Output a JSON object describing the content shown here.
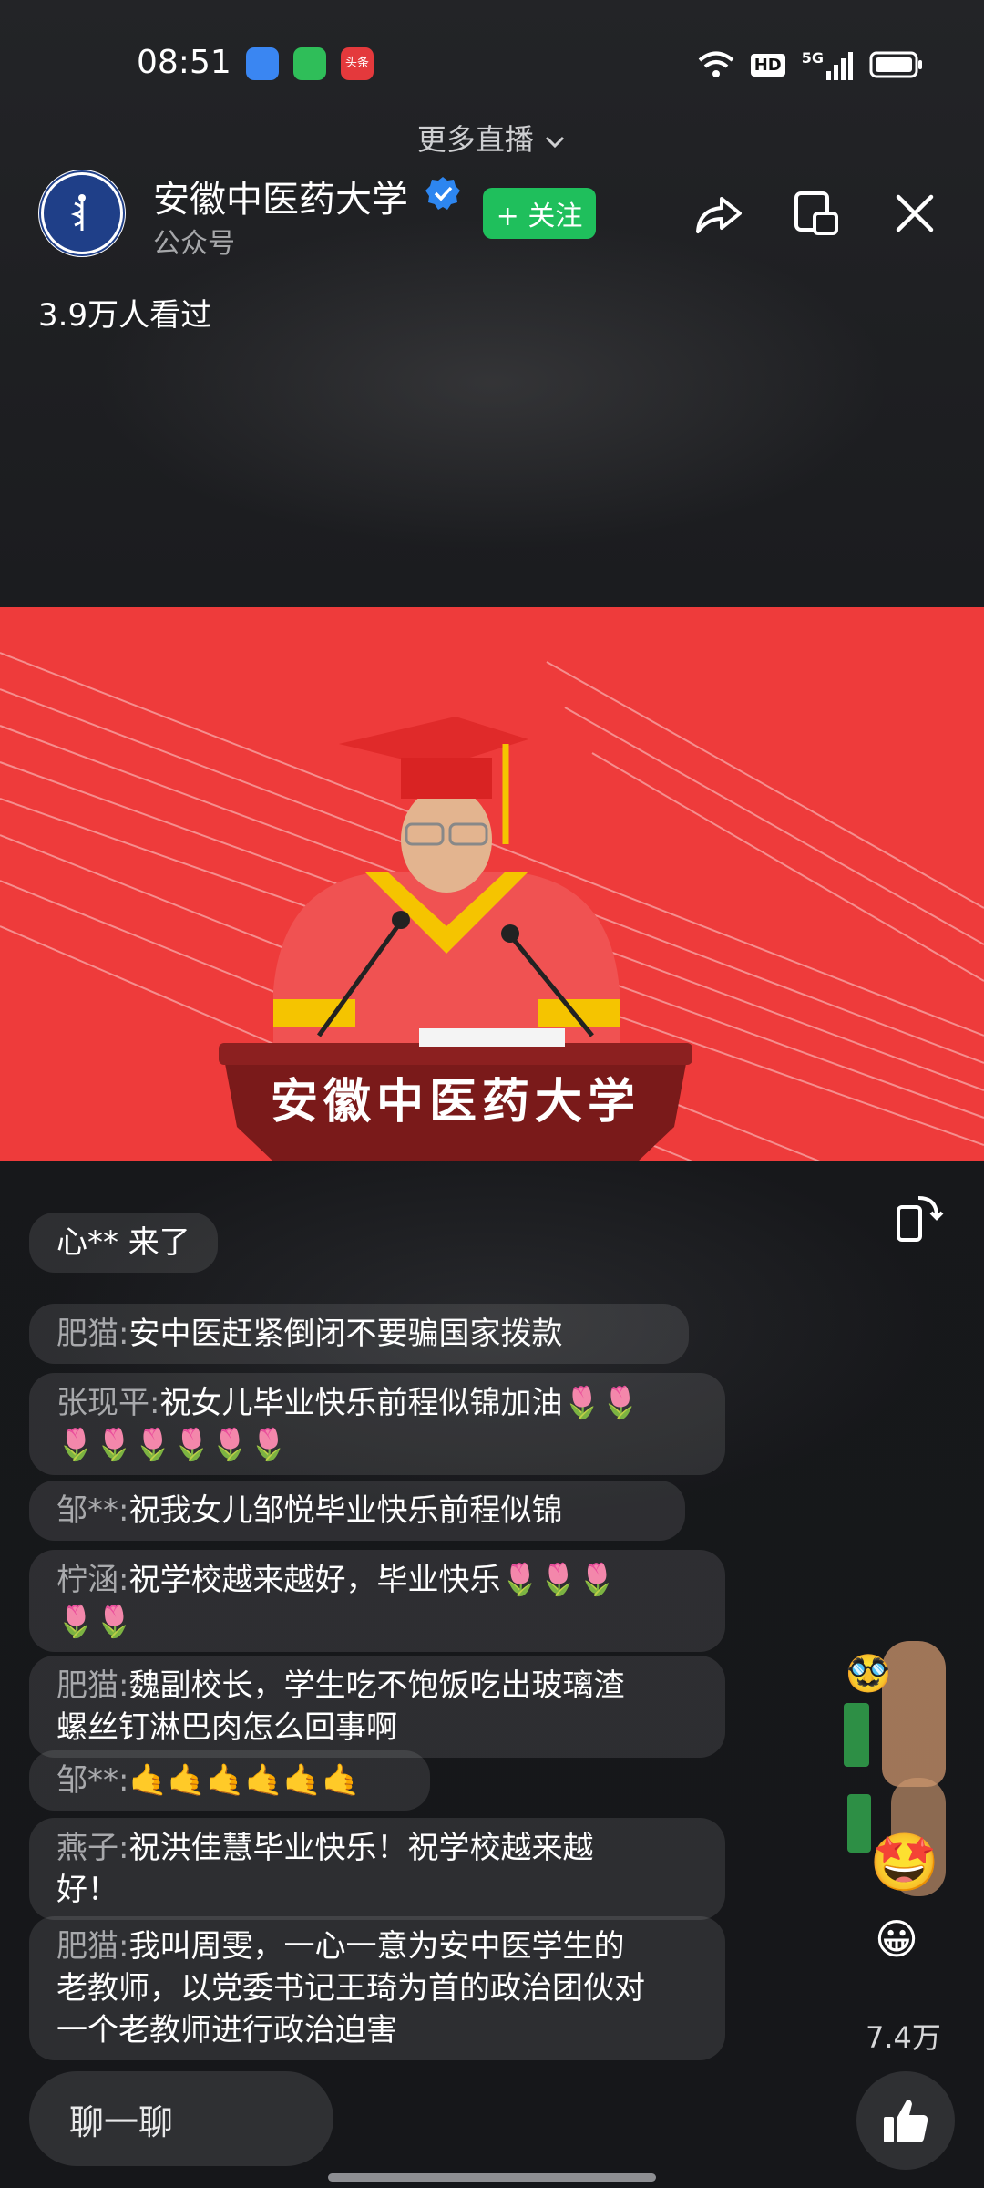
{
  "status_bar": {
    "time": "08:51",
    "hd": "HD",
    "net": "5G"
  },
  "header": {
    "more_live": "更多直播",
    "account_name": "安徽中医药大学",
    "account_type": "公众号",
    "follow_label": "+ 关注",
    "viewers": "3.9万人看过"
  },
  "video": {
    "podium_text": "安徽中医药大学"
  },
  "feed": {
    "join_notice": "心** 来了",
    "comments": [
      {
        "name": "肥猫:",
        "text": "安中医赶紧倒闭不要骗国家拨款"
      },
      {
        "name": "张现平:",
        "text": "祝女儿毕业快乐前程似锦加油🌷🌷",
        "text2": "🌷🌷🌷🌷🌷🌷"
      },
      {
        "name": "邹**:",
        "text": "祝我女儿邹悦毕业快乐前程似锦"
      },
      {
        "name": "柠涵:",
        "text": "祝学校越来越好，毕业快乐🌷🌷🌷",
        "text2": "🌷🌷"
      },
      {
        "name": "肥猫:",
        "text": "魏副校长，学生吃不饱饭吃出玻璃渣",
        "text2": "螺丝钉淋巴肉怎么回事啊"
      },
      {
        "name": "邹**:",
        "text": "🤙🤙🤙🤙🤙🤙"
      },
      {
        "name": "燕子:",
        "text": "祝洪佳慧毕业快乐！祝学校越来越",
        "text2": "好！"
      },
      {
        "name": "肥猫:",
        "text": "我叫周雯，一心一意为安中医学生的",
        "text2": "老教师，以党委书记王琦为首的政治团伙对",
        "text3": "一个老教师进行政治迫害"
      }
    ]
  },
  "bottom": {
    "likes": "7.4万",
    "chat_placeholder": "聊一聊"
  },
  "colors": {
    "follow": "#1fbf5c",
    "video_bg": "#ee3b3b",
    "accent_blue": "#2d86f0"
  }
}
